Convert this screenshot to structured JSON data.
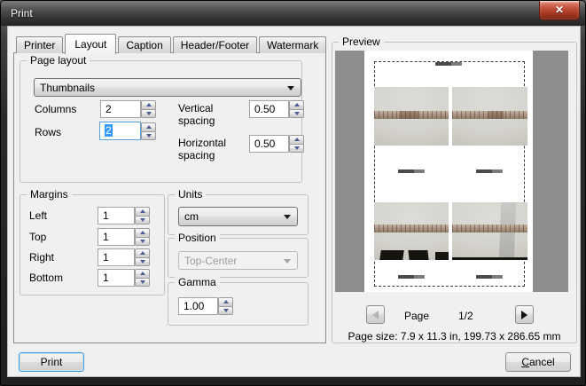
{
  "window": {
    "title": "Print",
    "close_glyph": "✕"
  },
  "active_tab": "Layout",
  "tabs": [
    {
      "label": "Printer"
    },
    {
      "label": "Layout"
    },
    {
      "label": "Caption"
    },
    {
      "label": "Header/Footer"
    },
    {
      "label": "Watermark"
    }
  ],
  "page_layout": {
    "group_label": "Page layout",
    "layout_value": "Thumbnails",
    "columns_label": "Columns",
    "columns_value": "2",
    "rows_label": "Rows",
    "rows_value": "2",
    "vertical_label": "Vertical spacing",
    "vertical_value": "0.50",
    "horizontal_label": "Horizontal spacing",
    "horizontal_value": "0.50"
  },
  "margins": {
    "group_label": "Margins",
    "left_label": "Left",
    "left_value": "1",
    "top_label": "Top",
    "top_value": "1",
    "right_label": "Right",
    "right_value": "1",
    "bottom_label": "Bottom",
    "bottom_value": "1"
  },
  "units": {
    "group_label": "Units",
    "value": "cm"
  },
  "position": {
    "group_label": "Position",
    "value": "Top-Center",
    "disabled": true
  },
  "gamma": {
    "group_label": "Gamma",
    "value": "1.00"
  },
  "preview": {
    "group_label": "Preview",
    "page_label": "Page",
    "page_indicator": "1/2",
    "page_size_text": "Page size: 7.9 x 11.3 in, 199.73 x 286.65 mm",
    "thumbnail_grid": {
      "columns": 2,
      "rows": 2
    }
  },
  "buttons": {
    "print": "Print",
    "cancel_accel": "C",
    "cancel_rest": "ancel"
  },
  "colors": {
    "selection": "#3399ff",
    "focus_border": "#56a0dc",
    "close_button_red": "#b0402e",
    "preview_background": "#8d8d8d",
    "client_background": "#f0f0f0"
  }
}
